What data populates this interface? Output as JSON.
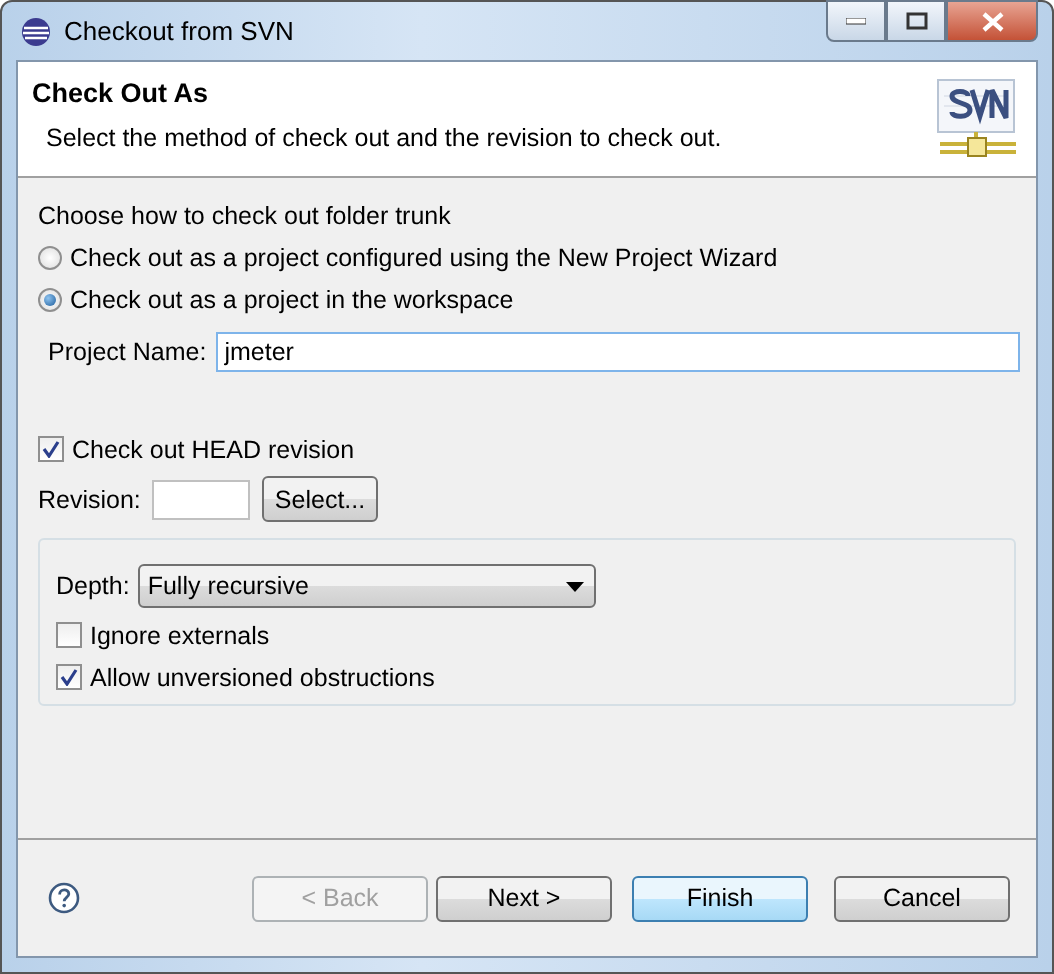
{
  "window": {
    "title": "Checkout from SVN"
  },
  "header": {
    "title": "Check Out As",
    "description": "Select the method of check out and the revision to check out."
  },
  "method": {
    "label": "Choose how to check out folder trunk",
    "options": [
      {
        "label": "Check out as a project configured using the New Project Wizard",
        "selected": false
      },
      {
        "label": "Check out as a project in the workspace",
        "selected": true
      }
    ]
  },
  "project_name": {
    "label": "Project Name:",
    "value": "jmeter"
  },
  "head_revision": {
    "label": "Check out HEAD revision",
    "checked": true
  },
  "revision": {
    "label": "Revision:",
    "button": {
      "label": "Select..."
    }
  },
  "depth": {
    "label": "Depth:",
    "value": "Fully recursive"
  },
  "options": [
    {
      "label": "Ignore externals",
      "checked": false
    },
    {
      "label": "Allow unversioned obstructions",
      "checked": true
    }
  ],
  "buttons": [
    {
      "label": "< Back",
      "disabled": true,
      "default": false
    },
    {
      "label": "Next >",
      "disabled": false,
      "default": false
    },
    {
      "label": "Finish",
      "disabled": false,
      "default": true
    },
    {
      "label": "Cancel",
      "disabled": false,
      "default": false
    }
  ]
}
